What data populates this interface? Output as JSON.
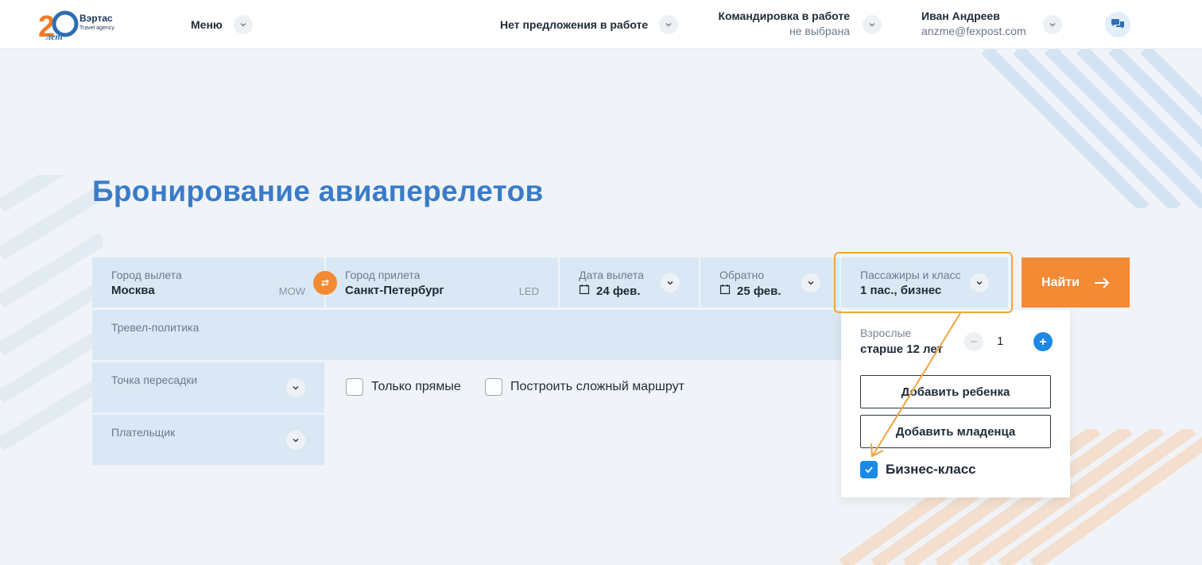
{
  "header": {
    "logo_brand": "Вэртас",
    "logo_tagline": "Travel agency",
    "logo_badge": "20 лет",
    "menu_label": "Меню",
    "offer_label": "Нет предложения в работе",
    "trip_title": "Командировка в работе",
    "trip_value": "не выбрана",
    "user_name": "Иван Андреев",
    "user_email": "anzme@fexpost.com"
  },
  "page_title": "Бронирование авиаперелетов",
  "search": {
    "from": {
      "label": "Город вылета",
      "value": "Москва",
      "code": "MOW"
    },
    "to": {
      "label": "Город прилета",
      "value": "Санкт-Петербург",
      "code": "LED"
    },
    "depart": {
      "label": "Дата вылета",
      "value": "24 фев."
    },
    "return": {
      "label": "Обратно",
      "value": "25 фев."
    },
    "passengers": {
      "label": "Пассажиры и класс",
      "value": "1 пас., бизнес"
    },
    "find_label": "Найти",
    "travel_policy_label": "Тревел-политика",
    "transfer_label": "Точка пересадки",
    "payer_label": "Плательщик",
    "direct_only_label": "Только прямые",
    "direct_only_checked": false,
    "complex_route_label": "Построить сложный маршрут",
    "complex_route_checked": false
  },
  "passenger_dropdown": {
    "adults_label": "Взрослые",
    "adults_sub": "старше 12 лет",
    "adults_count": "1",
    "add_child_label": "Добавить ребенка",
    "add_infant_label": "Добавить младенца",
    "business_label": "Бизнес-класс",
    "business_checked": true
  },
  "colors": {
    "accent_orange": "#f48a33",
    "title_blue": "#3a7bc8",
    "field_bg": "#d9e8f4",
    "check_blue": "#1e88e5",
    "highlight": "#f0a43c"
  }
}
